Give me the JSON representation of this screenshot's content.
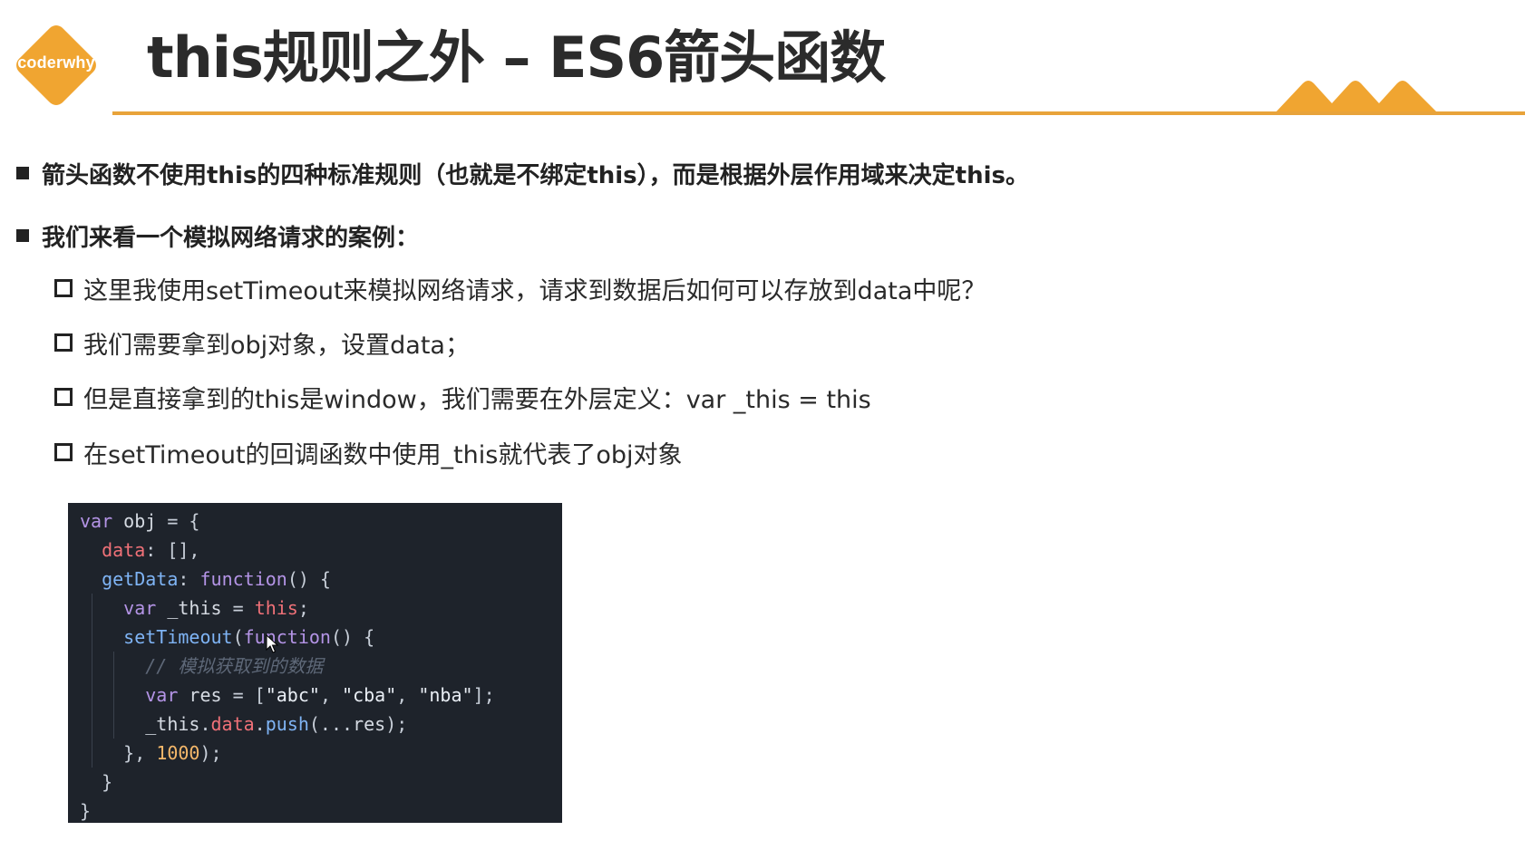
{
  "logo": {
    "text": "coderwhy"
  },
  "title": "this规则之外 – ES6箭头函数",
  "accent_color": "#f0a531",
  "bullets": [
    "箭头函数不使用this的四种标准规则（也就是不绑定this），而是根据外层作用域来决定this。",
    "我们来看一个模拟网络请求的案例："
  ],
  "sub_items": [
    "这里我使用setTimeout来模拟网络请求，请求到数据后如何可以存放到data中呢？",
    "我们需要拿到obj对象，设置data；",
    "但是直接拿到的this是window，我们需要在外层定义：var _this = this",
    "在setTimeout的回调函数中使用_this就代表了obj对象"
  ],
  "code": {
    "lines": [
      "var obj = {",
      "  data: [],",
      "  getData: function() {",
      "    var _this = this;",
      "    setTimeout(function() {",
      "      // 模拟获取到的数据",
      "      var res = [\"abc\", \"cba\", \"nba\"];",
      "      _this.data.push(...res);",
      "    }, 1000);",
      "  }",
      "}"
    ]
  }
}
